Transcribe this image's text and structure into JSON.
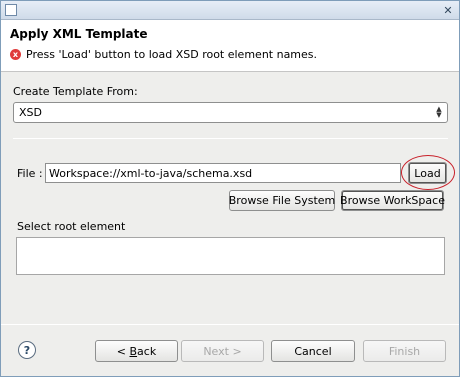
{
  "window": {
    "close_glyph": "✕"
  },
  "header": {
    "title": "Apply XML Template",
    "message": "Press 'Load' button to load XSD root element names.",
    "error_icon": "error-icon",
    "error_glyph": "x"
  },
  "template": {
    "label": "Create Template From:",
    "selected": "XSD",
    "arrow_up": "▲",
    "arrow_down": "▼"
  },
  "file": {
    "label": "File :",
    "value": "Workspace://xml-to-java/schema.xsd",
    "load_label": "Load",
    "browse_fs_label": "Browse File System",
    "browse_ws_label": "Browse WorkSpace"
  },
  "root": {
    "label": "Select root element"
  },
  "footer": {
    "help_glyph": "?",
    "back_label_prefix": "< ",
    "back_label_key": "B",
    "back_label_rest": "ack",
    "next_label": "Next >",
    "cancel_label": "Cancel",
    "finish_label": "Finish"
  },
  "colors": {
    "highlight_ring": "#c8202a",
    "error_icon": "#e03b3b"
  }
}
